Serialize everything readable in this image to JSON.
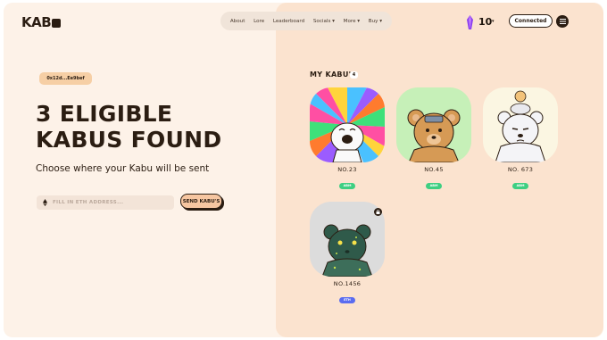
{
  "brand": {
    "logo_text": "KAB"
  },
  "nav": {
    "items": [
      "About",
      "Lore",
      "Leaderboard",
      "Socials",
      "More",
      "Buy"
    ]
  },
  "wallet": {
    "gem_count": "10",
    "connect_label": "Connected"
  },
  "left": {
    "address": "0x12d...Ee9bef",
    "headline_line1": "3 ELIGIBLE",
    "headline_line2": "KABUS FOUND",
    "subheading": "Choose where your Kabu will be sent",
    "input_placeholder": "FILL IN ETH ADDRESS...",
    "send_label": "SEND KABU'S"
  },
  "collection": {
    "title": "MY KABU'S",
    "count": "4",
    "items": [
      {
        "name": "NO.23",
        "tag": "ABM",
        "tag_color": "#3ecf82"
      },
      {
        "name": "NO.45",
        "tag": "ABM",
        "tag_color": "#3ecf82"
      },
      {
        "name": "NO. 673",
        "tag": "ABM",
        "tag_color": "#3ecf82"
      },
      {
        "name": "NO.1456",
        "tag": "ETH",
        "tag_color": "#5a6cf0"
      }
    ]
  },
  "colors": {
    "dark": "#2b1d12",
    "cream": "#fdf2e8",
    "peach": "#fbe3cf",
    "button": "#f6c6a1"
  },
  "icons": [
    "menu-icon",
    "gem-icon",
    "eth-icon",
    "lock-icon",
    "chevron-down-icon"
  ]
}
